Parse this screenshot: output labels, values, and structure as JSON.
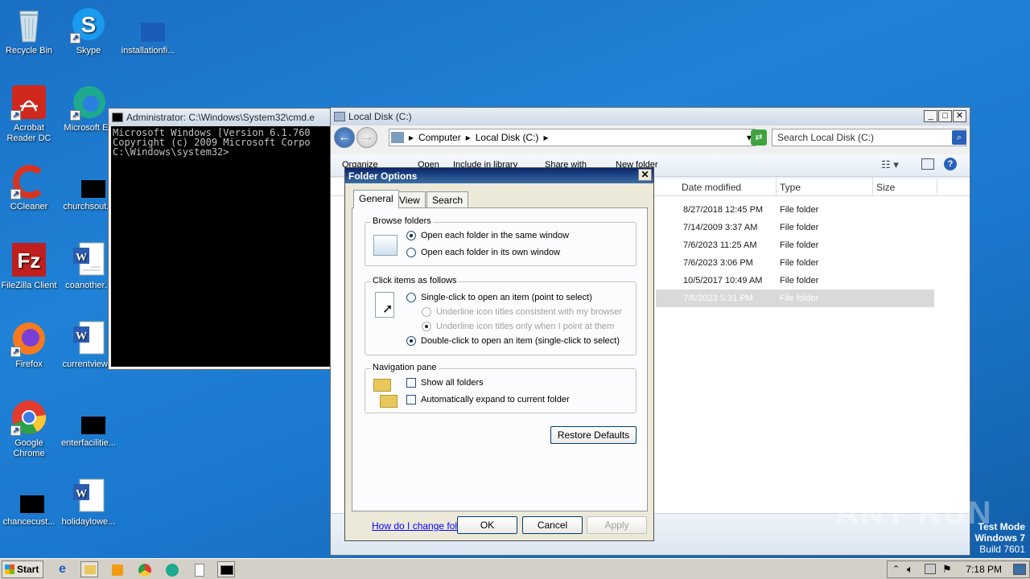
{
  "desktop": {
    "icons": [
      {
        "label": "Recycle Bin"
      },
      {
        "label": "Skype"
      },
      {
        "label": "installationfi..."
      },
      {
        "label": "Acrobat Reader DC"
      },
      {
        "label": "Microsoft Ed"
      },
      {
        "label": "CCleaner"
      },
      {
        "label": "churchsout..."
      },
      {
        "label": "FileZilla Client"
      },
      {
        "label": "coanother..."
      },
      {
        "label": "Firefox"
      },
      {
        "label": "currentview..."
      },
      {
        "label": "Google Chrome"
      },
      {
        "label": "enterfacilitie..."
      },
      {
        "label": "chancecust..."
      },
      {
        "label": "holidaylowe..."
      }
    ]
  },
  "cmd": {
    "title": "Administrator: C:\\Windows\\System32\\cmd.e",
    "lines": [
      "Microsoft Windows [Version 6.1.760",
      "Copyright (c) 2009 Microsoft Corpo",
      "",
      "C:\\Windows\\system32>"
    ]
  },
  "explorer": {
    "title": "Local Disk (C:)",
    "breadcrumb": [
      "Computer",
      "Local Disk (C:)"
    ],
    "search_placeholder": "Search Local Disk (C:)",
    "toolbar": [
      "Organize",
      "Open",
      "Include in library",
      "Share with",
      "New folder"
    ],
    "columns": [
      "Date modified",
      "Type",
      "Size"
    ],
    "rows": [
      {
        "date": "8/27/2018 12:45 PM",
        "type": "File folder"
      },
      {
        "date": "7/14/2009 3:37 AM",
        "type": "File folder"
      },
      {
        "date": "7/6/2023 11:25 AM",
        "type": "File folder"
      },
      {
        "date": "7/6/2023 3:06 PM",
        "type": "File folder"
      },
      {
        "date": "10/5/2017 10:49 AM",
        "type": "File folder"
      },
      {
        "date": "7/6/2023 5:31 PM",
        "type": "File folder"
      }
    ]
  },
  "dialog": {
    "title": "Folder Options",
    "tabs": [
      "General",
      "View",
      "Search"
    ],
    "browse_folders": {
      "title": "Browse folders",
      "same_window": "Open each folder in the same window",
      "own_window": "Open each folder in its own window"
    },
    "click_items": {
      "title": "Click items as follows",
      "single_click": "Single-click to open an item (point to select)",
      "underline_consistent": "Underline icon titles consistent with my browser",
      "underline_point": "Underline icon titles only when I point at them",
      "double_click": "Double-click to open an item (single-click to select)"
    },
    "nav_pane": {
      "title": "Navigation pane",
      "show_all": "Show all folders",
      "auto_expand": "Automatically expand to current folder"
    },
    "restore_defaults": "Restore Defaults",
    "help_link": "How do I change folder options?",
    "ok": "OK",
    "cancel": "Cancel",
    "apply": "Apply"
  },
  "taskbar": {
    "start": "Start",
    "clock": "7:18 PM"
  },
  "watermark": {
    "line1": "Test Mode",
    "line2": "Windows 7",
    "line3": "Build 7601",
    "brand": "ANY RUN"
  }
}
